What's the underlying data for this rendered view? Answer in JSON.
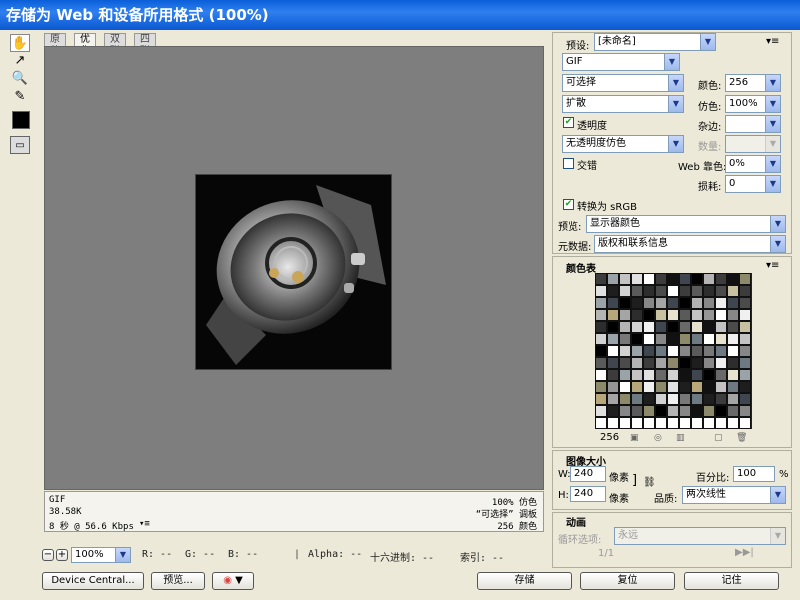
{
  "window": {
    "title": "存储为 Web 和设备所用格式 (100%)"
  },
  "toolbox": {
    "tools": [
      "✋",
      "↗",
      "🔍",
      "✎"
    ]
  },
  "tabs": [
    {
      "label": "原稿"
    },
    {
      "label": "优化"
    },
    {
      "label": "双联"
    },
    {
      "label": "四联"
    }
  ],
  "active_tab": "优化",
  "info_left": {
    "format": "GIF",
    "size": "38.58K",
    "time": "8 秒 @ 56.6 Kbps"
  },
  "info_right": {
    "dither": "100% 仿色",
    "palette": "“可选择” 调板",
    "colors": "256 颜色"
  },
  "status_bar": {
    "zoom": "100%",
    "r": "R: --",
    "g": "G: --",
    "b": "B: --",
    "alpha": "Alpha: --",
    "hex": "十六进制: --",
    "index": "索引: --"
  },
  "bottom_buttons": {
    "device_central": "Device Central...",
    "preview": "预览...",
    "save": "存储",
    "reset": "复位",
    "remember": "记住"
  },
  "settings": {
    "preset_label": "预设:",
    "preset_value": "[未命名]",
    "format_value": "GIF",
    "reduction": "可选择",
    "colors_label": "颜色:",
    "colors_value": "256",
    "dither_algo": "扩散",
    "dither_label": "仿色:",
    "dither_value": "100%",
    "transparency_label": "透明度",
    "matte_label": "杂边:",
    "matte_value": "",
    "transp_dither": "无透明度仿色",
    "amount_label": "数量:",
    "amount_value": "",
    "interlaced_label": "交错",
    "websnap_label": "Web 靠色:",
    "websnap_value": "0%",
    "lossy_label": "损耗:",
    "lossy_value": "0",
    "srgb_label": "转换为 sRGB",
    "preview_label": "预览:",
    "preview_value": "显示器颜色",
    "metadata_label": "元数据:",
    "metadata_value": "版权和联系信息"
  },
  "color_table": {
    "title": "颜色表",
    "count": "256"
  },
  "image_size": {
    "title": "图像大小",
    "w_label": "W:",
    "w_value": "240",
    "h_label": "H:",
    "h_value": "240",
    "unit": "像素",
    "pct_label": "百分比:",
    "pct_value": "100",
    "pct_unit": "%",
    "quality_label": "品质:",
    "quality_value": "两次线性"
  },
  "animation": {
    "title": "动画",
    "loop_label": "循环选项:",
    "loop_value": "永远",
    "frame": "1/1"
  }
}
